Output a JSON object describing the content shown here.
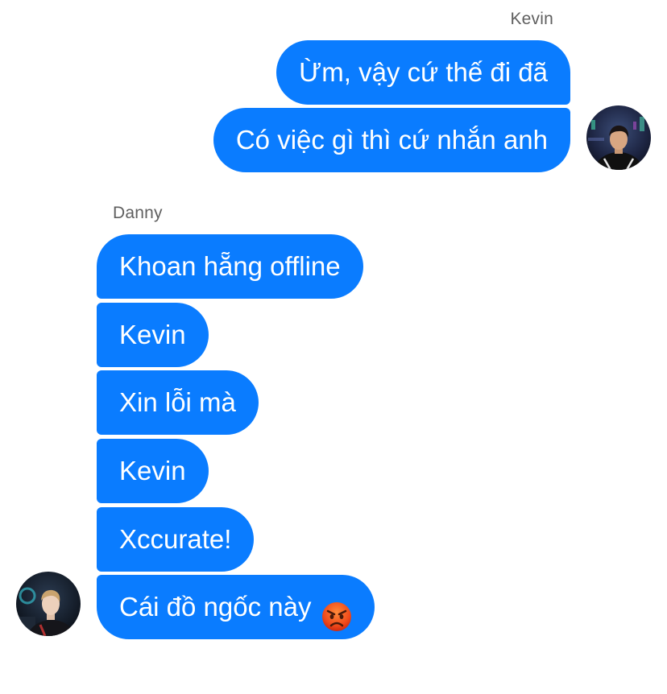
{
  "outgoing": {
    "sender": "Kevin",
    "messages": [
      {
        "text": "Ừm, vậy cứ thế đi đã"
      },
      {
        "text": "Có việc gì thì cứ nhắn anh"
      }
    ],
    "avatar_icon": "kevin-avatar"
  },
  "incoming": {
    "sender": "Danny",
    "messages": [
      {
        "text": "Khoan hẵng offline"
      },
      {
        "text": "Kevin"
      },
      {
        "text": "Xin lỗi mà"
      },
      {
        "text": "Kevin"
      },
      {
        "text": "Xccurate!"
      },
      {
        "text": "Cái đồ ngốc này",
        "emoji": "angry-face-icon"
      }
    ],
    "avatar_icon": "danny-avatar"
  },
  "colors": {
    "bubble": "#0a7cff",
    "bubble_text": "#ffffff",
    "sender_name": "#5f5f5f",
    "background": "#ffffff"
  }
}
